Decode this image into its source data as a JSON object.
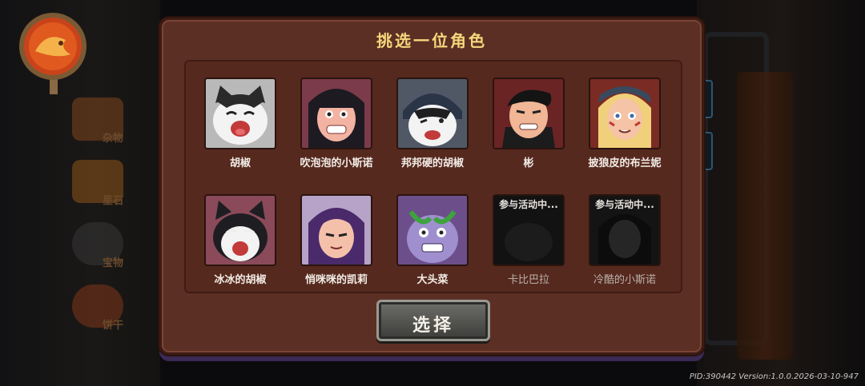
{
  "sidebar": {
    "items": [
      {
        "label": "杂物",
        "icon": "food-icon"
      },
      {
        "label": "星石",
        "icon": "star-icon"
      },
      {
        "label": "宝物",
        "icon": "treasure-icon"
      },
      {
        "label": "饼干",
        "icon": "cookie-icon"
      }
    ]
  },
  "dialog": {
    "title": "挑选一位角色",
    "select_label": "选择",
    "characters": [
      {
        "name": "胡椒",
        "locked": false,
        "tag": ""
      },
      {
        "name": "吹泡泡的小斯诺",
        "locked": false,
        "tag": ""
      },
      {
        "name": "邦邦硬的胡椒",
        "locked": false,
        "tag": ""
      },
      {
        "name": "彬",
        "locked": false,
        "tag": ""
      },
      {
        "name": "披狼皮的布兰妮",
        "locked": false,
        "tag": ""
      },
      {
        "name": "冰冰的胡椒",
        "locked": false,
        "tag": ""
      },
      {
        "name": "悄咪咪的凯莉",
        "locked": false,
        "tag": ""
      },
      {
        "name": "大头菜",
        "locked": false,
        "tag": ""
      },
      {
        "name": "卡比巴拉",
        "locked": true,
        "tag": "参与活动中..."
      },
      {
        "name": "冷酷的小斯诺",
        "locked": true,
        "tag": "参与活动中..."
      }
    ]
  },
  "footer": {
    "build_info": "PID:390442 Version:1.0.0.2026-03-10-947"
  },
  "colors": {
    "dialog_bg": "#5c2f24",
    "title": "#f6d77c",
    "inner_bg": "#56291e"
  }
}
